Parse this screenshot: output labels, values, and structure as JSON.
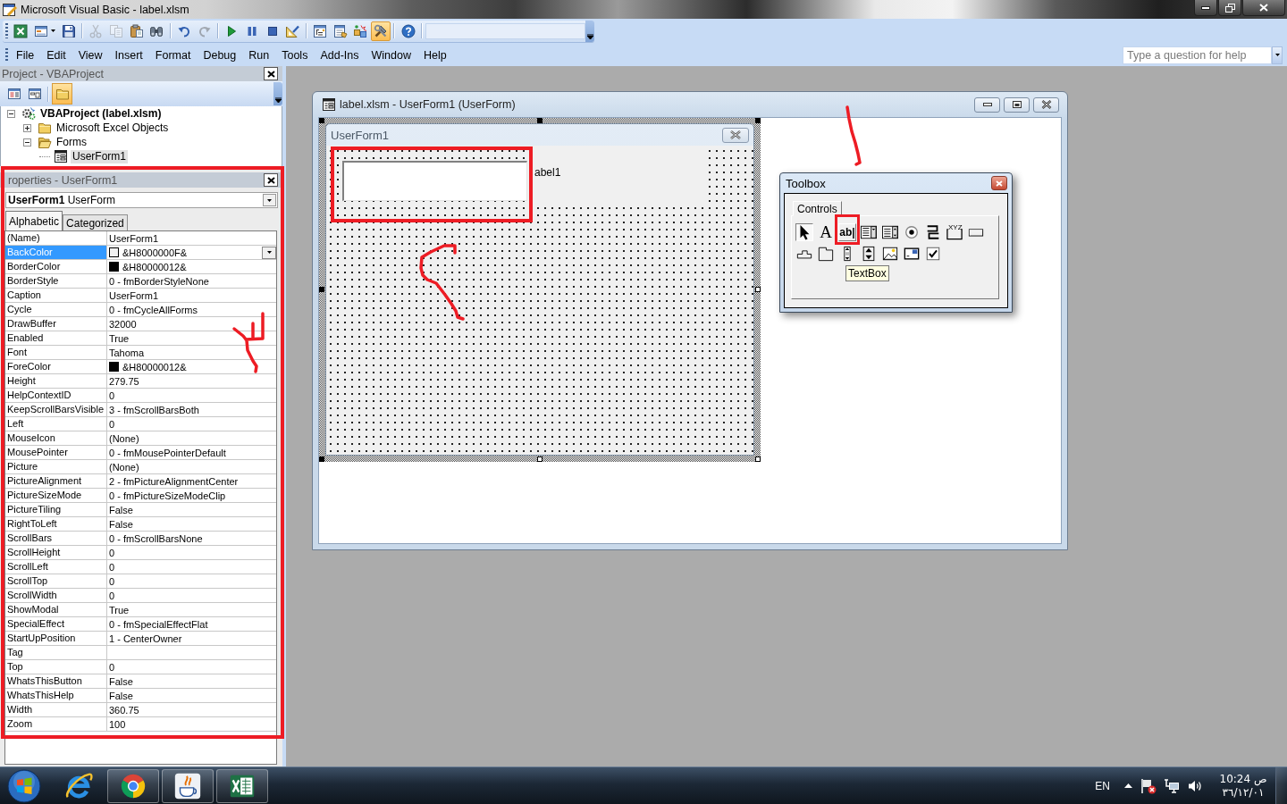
{
  "window": {
    "title": "Microsoft Visual Basic - label.xlsm"
  },
  "toolbar": {
    "buttons": [
      {
        "pressed": false,
        "disabled": false
      },
      {
        "pressed": false,
        "disabled": false
      },
      {
        "pressed": false,
        "disabled": false
      },
      {
        "pressed": false,
        "disabled": true
      },
      {
        "pressed": false,
        "disabled": true
      },
      {
        "pressed": false,
        "disabled": false
      },
      {
        "pressed": false,
        "disabled": false
      },
      {
        "pressed": false,
        "disabled": false
      },
      {
        "pressed": false,
        "disabled": true
      },
      {
        "pressed": false,
        "disabled": false
      },
      {
        "pressed": false,
        "disabled": false
      },
      {
        "pressed": false,
        "disabled": false
      },
      {
        "pressed": false,
        "disabled": false
      },
      {
        "pressed": false,
        "disabled": false
      },
      {
        "pressed": false,
        "disabled": false
      },
      {
        "pressed": false,
        "disabled": false
      },
      {
        "pressed": true,
        "disabled": false
      },
      {
        "pressed": false,
        "disabled": false
      }
    ]
  },
  "menu": [
    "File",
    "Edit",
    "View",
    "Insert",
    "Format",
    "Debug",
    "Run",
    "Tools",
    "Add-Ins",
    "Window",
    "Help"
  ],
  "help_box": {
    "placeholder": "Type a question for help"
  },
  "project": {
    "title": "Project - VBAProject",
    "toolbar": [
      {
        "pressed": false
      },
      {
        "pressed": false
      },
      {
        "pressed": true
      }
    ],
    "tree": [
      {
        "kind": "project",
        "label": "VBAProject (label.xlsm)",
        "expanded": true,
        "selected": false,
        "children": [
          {
            "kind": "folder",
            "label": "Microsoft Excel Objects",
            "expanded": false,
            "selected": false
          },
          {
            "kind": "folder",
            "label": "Forms",
            "expanded": true,
            "selected": false,
            "children": [
              {
                "kind": "form",
                "label": "UserForm1",
                "selected": true
              }
            ]
          }
        ]
      }
    ]
  },
  "properties": {
    "title": "roperties - UserForm1",
    "object": "**UserForm1** UserForm",
    "tabs": [
      {
        "label": "Alphabetic",
        "selected": true
      },
      {
        "label": "Categorized",
        "selected": false
      }
    ],
    "rows": [
      {
        "name": "(Name)",
        "value": "UserForm1",
        "selected": false
      },
      {
        "name": "BackColor",
        "value": "&H8000000F&",
        "color": "#f0f0f0",
        "selected": true
      },
      {
        "name": "BorderColor",
        "value": "&H80000012&",
        "color": "#000000",
        "selected": false
      },
      {
        "name": "BorderStyle",
        "value": "0 - fmBorderStyleNone",
        "selected": false
      },
      {
        "name": "Caption",
        "value": "UserForm1",
        "selected": false
      },
      {
        "name": "Cycle",
        "value": "0 - fmCycleAllForms",
        "selected": false
      },
      {
        "name": "DrawBuffer",
        "value": "32000",
        "selected": false
      },
      {
        "name": "Enabled",
        "value": "True",
        "selected": false
      },
      {
        "name": "Font",
        "value": "Tahoma",
        "selected": false
      },
      {
        "name": "ForeColor",
        "value": "&H80000012&",
        "color": "#000000",
        "selected": false
      },
      {
        "name": "Height",
        "value": "279.75",
        "selected": false
      },
      {
        "name": "HelpContextID",
        "value": "0",
        "selected": false
      },
      {
        "name": "KeepScrollBarsVisible",
        "value": "3 - fmScrollBarsBoth",
        "selected": false
      },
      {
        "name": "Left",
        "value": "0",
        "selected": false
      },
      {
        "name": "MouseIcon",
        "value": "(None)",
        "selected": false
      },
      {
        "name": "MousePointer",
        "value": "0 - fmMousePointerDefault",
        "selected": false
      },
      {
        "name": "Picture",
        "value": "(None)",
        "selected": false
      },
      {
        "name": "PictureAlignment",
        "value": "2 - fmPictureAlignmentCenter",
        "selected": false
      },
      {
        "name": "PictureSizeMode",
        "value": "0 - fmPictureSizeModeClip",
        "selected": false
      },
      {
        "name": "PictureTiling",
        "value": "False",
        "selected": false
      },
      {
        "name": "RightToLeft",
        "value": "False",
        "selected": false
      },
      {
        "name": "ScrollBars",
        "value": "0 - fmScrollBarsNone",
        "selected": false
      },
      {
        "name": "ScrollHeight",
        "value": "0",
        "selected": false
      },
      {
        "name": "ScrollLeft",
        "value": "0",
        "selected": false
      },
      {
        "name": "ScrollTop",
        "value": "0",
        "selected": false
      },
      {
        "name": "ScrollWidth",
        "value": "0",
        "selected": false
      },
      {
        "name": "ShowModal",
        "value": "True",
        "selected": false
      },
      {
        "name": "SpecialEffect",
        "value": "0 - fmSpecialEffectFlat",
        "selected": false
      },
      {
        "name": "StartUpPosition",
        "value": "1 - CenterOwner",
        "selected": false
      },
      {
        "name": "Tag",
        "selected": false
      },
      {
        "name": "Top",
        "value": "0",
        "selected": false
      },
      {
        "name": "WhatsThisButton",
        "value": "False",
        "selected": false
      },
      {
        "name": "WhatsThisHelp",
        "value": "False",
        "selected": false
      },
      {
        "name": "Width",
        "value": "360.75",
        "selected": false
      },
      {
        "name": "Zoom",
        "value": "100",
        "selected": false
      }
    ]
  },
  "designer": {
    "title": "label.xlsm - UserForm1 (UserForm)",
    "form": {
      "caption": "UserForm1",
      "selected": true,
      "controls": [
        {
          "kind": "textbox"
        },
        {
          "kind": "label",
          "caption": "abel1"
        }
      ]
    }
  },
  "toolbox": {
    "title": "Toolbox",
    "tabs": [
      {
        "label": "Controls",
        "selected": true
      }
    ],
    "controls": [
      {
        "kind": "pointer",
        "selected": true,
        "hovered": false
      },
      {
        "kind": "label",
        "glyph": "A",
        "selected": false,
        "hovered": false
      },
      {
        "kind": "textbox",
        "glyph": "ab|",
        "selected": false,
        "hovered": true
      },
      {
        "kind": "combobox",
        "selected": false,
        "hovered": false
      },
      {
        "kind": "listbox",
        "selected": false,
        "hovered": false
      },
      {
        "kind": "optionbutton",
        "selected": false,
        "hovered": false
      },
      {
        "kind": "togglebutton",
        "selected": false,
        "hovered": false
      },
      {
        "kind": "frame",
        "glyph": "XYZ",
        "selected": false,
        "hovered": false
      },
      {
        "kind": "commandbutton",
        "selected": false,
        "hovered": false
      },
      {
        "kind": "tabstrip",
        "selected": false,
        "hovered": false
      },
      {
        "kind": "multipage",
        "selected": false,
        "hovered": false
      },
      {
        "kind": "scrollbar",
        "selected": false,
        "hovered": false
      },
      {
        "kind": "spinbutton",
        "selected": false,
        "hovered": false
      },
      {
        "kind": "image",
        "selected": false,
        "hovered": false
      },
      {
        "kind": "refedit",
        "selected": false,
        "hovered": false
      },
      {
        "kind": "checkbox",
        "selected": false,
        "hovered": false
      }
    ],
    "tooltip": "TextBox"
  },
  "taskbar": {
    "apps": [
      {
        "running": false
      },
      {
        "running": true
      },
      {
        "running": true
      },
      {
        "running": true
      }
    ],
    "language": "EN",
    "time": "10:24 ص",
    "date": "٣٦/١٢/٠١"
  }
}
